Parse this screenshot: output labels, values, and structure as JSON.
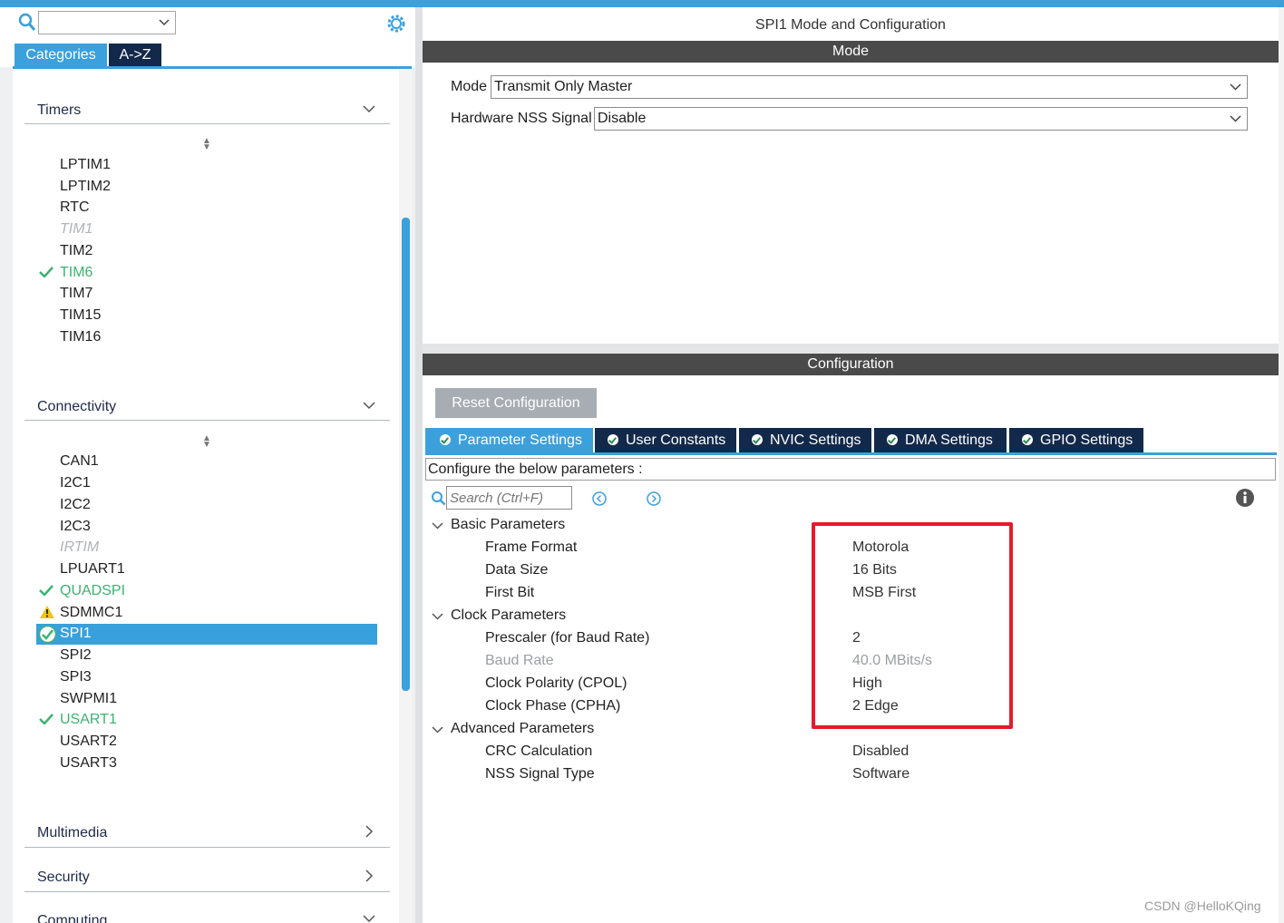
{
  "left_panel": {
    "search_value": "",
    "tabs": [
      "Categories",
      "A->Z"
    ],
    "groups": {
      "timers": "Timers",
      "connectivity": "Connectivity",
      "multimedia": "Multimedia",
      "security": "Security",
      "computing": "Computing"
    },
    "timers_items": [
      "LPTIM1",
      "LPTIM2",
      "RTC",
      "TIM1",
      "TIM2",
      "TIM6",
      "TIM7",
      "TIM15",
      "TIM16"
    ],
    "connectivity_items": [
      "CAN1",
      "I2C1",
      "I2C2",
      "I2C3",
      "IRTIM",
      "LPUART1",
      "QUADSPI",
      "SDMMC1",
      "SPI1",
      "SPI2",
      "SPI3",
      "SWPMI1",
      "USART1",
      "USART2",
      "USART3"
    ]
  },
  "right_panel": {
    "title": "SPI1 Mode and Configuration",
    "mode_header": "Mode",
    "mode_label": "Mode",
    "mode_value": "Transmit Only Master",
    "nss_label": "Hardware NSS Signal",
    "nss_value": "Disable",
    "config_header": "Configuration",
    "reset_button": "Reset Configuration",
    "tabs": [
      "Parameter Settings",
      "User Constants",
      "NVIC Settings",
      "DMA Settings",
      "GPIO Settings"
    ],
    "configure_text": "Configure the below parameters :",
    "search_placeholder": "Search (Ctrl+F)",
    "sections": {
      "basic": "Basic Parameters",
      "clock": "Clock Parameters",
      "advanced": "Advanced Parameters"
    },
    "params": [
      {
        "name": "Frame Format",
        "value": "Motorola"
      },
      {
        "name": "Data Size",
        "value": "16 Bits"
      },
      {
        "name": "First Bit",
        "value": "MSB First"
      },
      {
        "name": "Prescaler (for Baud Rate)",
        "value": "2"
      },
      {
        "name": "Baud Rate",
        "value": "40.0 MBits/s"
      },
      {
        "name": "Clock Polarity (CPOL)",
        "value": "High"
      },
      {
        "name": "Clock Phase (CPHA)",
        "value": "2 Edge"
      },
      {
        "name": "CRC Calculation",
        "value": "Disabled"
      },
      {
        "name": "NSS Signal Type",
        "value": "Software"
      }
    ]
  },
  "watermark": "CSDN @HelloKQing",
  "colors": {
    "accent": "#3ca0dc",
    "dark_tab": "#13294b",
    "highlight_box": "#e8192c",
    "enabled_green": "#3cb371"
  }
}
